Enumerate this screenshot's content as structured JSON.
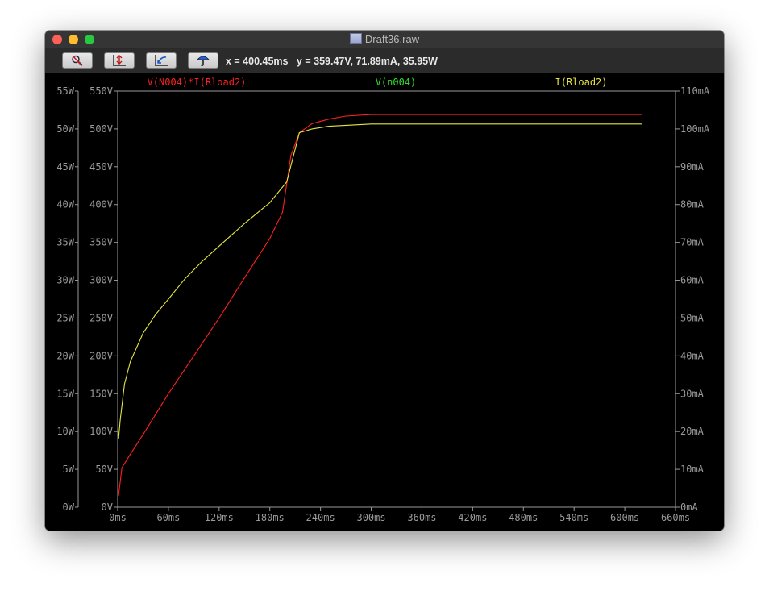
{
  "window": {
    "title": "Draft36.raw"
  },
  "toolbar": {
    "buttons": [
      {
        "name": "zoom-tool-button",
        "icon": "magnifier-icon"
      },
      {
        "name": "autorange-y-button",
        "icon": "autorange-icon"
      },
      {
        "name": "zoom-back-button",
        "icon": "zoom-back-icon"
      },
      {
        "name": "probe-button",
        "icon": "probe-icon"
      }
    ],
    "readout": "x = 400.45ms   y = 359.47V, 71.89mA, 35.95W"
  },
  "colors": {
    "power": "#ff2020",
    "voltage": "#30e030",
    "current": "#e6e640",
    "axis": "#9a9a9a"
  },
  "chart_data": {
    "type": "line",
    "x_ticks": [
      "0ms",
      "60ms",
      "120ms",
      "180ms",
      "240ms",
      "300ms",
      "360ms",
      "420ms",
      "480ms",
      "540ms",
      "600ms",
      "660ms"
    ],
    "x_range_ms": [
      0,
      660
    ],
    "left_outer_ticks": [
      "0W",
      "5W",
      "10W",
      "15W",
      "20W",
      "25W",
      "30W",
      "35W",
      "40W",
      "45W",
      "50W",
      "55W"
    ],
    "left_inner_ticks": [
      "0V",
      "50V",
      "100V",
      "150V",
      "200V",
      "250V",
      "300V",
      "350V",
      "400V",
      "450V",
      "500V",
      "550V"
    ],
    "right_ticks": [
      "0mA",
      "10mA",
      "20mA",
      "30mA",
      "40mA",
      "50mA",
      "60mA",
      "70mA",
      "80mA",
      "90mA",
      "100mA",
      "110mA"
    ],
    "legend": {
      "power": "V(N004)*I(Rload2)",
      "voltage": "V(n004)",
      "current": "I(Rload2)"
    },
    "series": [
      {
        "name": "V(N004)*I(Rload2)",
        "axis": "W",
        "x": [
          1,
          5,
          15,
          30,
          60,
          90,
          120,
          150,
          180,
          195,
          205,
          215,
          230,
          250,
          270,
          300,
          400,
          500,
          620
        ],
        "y": [
          1.5,
          5.2,
          7.0,
          9.6,
          15.0,
          20.0,
          25.0,
          30.3,
          35.5,
          39.0,
          46.5,
          49.5,
          50.7,
          51.3,
          51.7,
          51.9,
          51.9,
          51.9,
          51.9
        ]
      },
      {
        "name": "I(Rload2)",
        "axis": "mA",
        "x": [
          1,
          3,
          8,
          15,
          30,
          45,
          60,
          80,
          100,
          120,
          150,
          180,
          200,
          215,
          230,
          250,
          300,
          400,
          620
        ],
        "y": [
          18.0,
          23.0,
          32.5,
          38.5,
          46.0,
          51.0,
          55.0,
          60.5,
          65.0,
          69.0,
          75.0,
          80.5,
          86.0,
          99.0,
          100.0,
          100.7,
          101.3,
          101.3,
          101.3
        ]
      }
    ]
  }
}
